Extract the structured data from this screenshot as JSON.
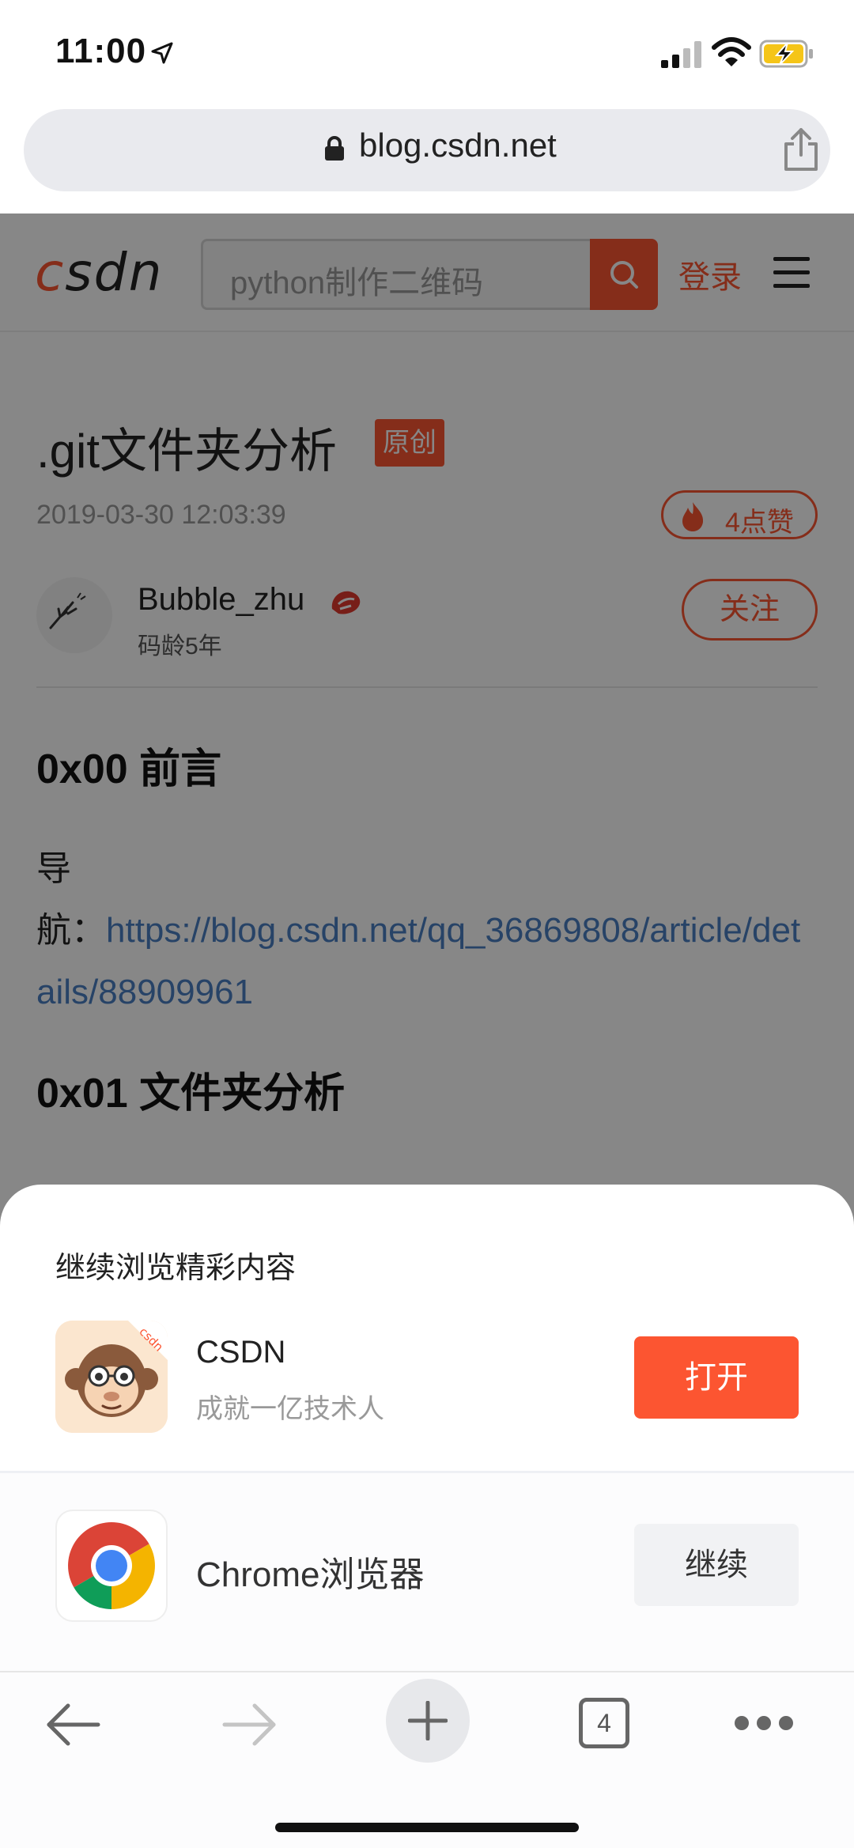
{
  "status_bar": {
    "time": "11:00",
    "icons": [
      "location-arrow-icon",
      "cellular-signal-icon",
      "wifi-icon",
      "battery-charging-icon"
    ]
  },
  "browser": {
    "url": "blog.csdn.net",
    "toolbar": {
      "tab_count": "4",
      "icons": [
        "back-arrow-icon",
        "forward-arrow-icon",
        "plus-icon",
        "tabs-icon",
        "more-dots-icon"
      ]
    }
  },
  "page": {
    "logo": {
      "c": "c",
      "rest": "sdn"
    },
    "search_placeholder": "python制作二维码",
    "login": "登录",
    "article": {
      "title": ".git文件夹分析",
      "badge": "原创",
      "date": "2019-03-30 12:03:39",
      "likes": "4点赞",
      "author": "Bubble_zhu",
      "author_age": "码龄5年",
      "follow": "关注",
      "heading_1": "0x00 前言",
      "nav_label_1": "导",
      "nav_label_2": "航：",
      "nav_link": "https://blog.csdn.net/qq_36869808/article/details/88909961",
      "heading_2": "0x01 文件夹分析"
    }
  },
  "sheet": {
    "title": "继续浏览精彩内容",
    "app": {
      "name": "CSDN",
      "desc": "成就一亿技术人",
      "open": "打开",
      "icon_tag": "csdn"
    },
    "browser": {
      "name": "Chrome浏览器",
      "continue": "继续"
    }
  },
  "colors": {
    "accent": "#fc5531",
    "link": "#4a7fc2",
    "overlay": "rgba(0,0,0,0.47)"
  }
}
